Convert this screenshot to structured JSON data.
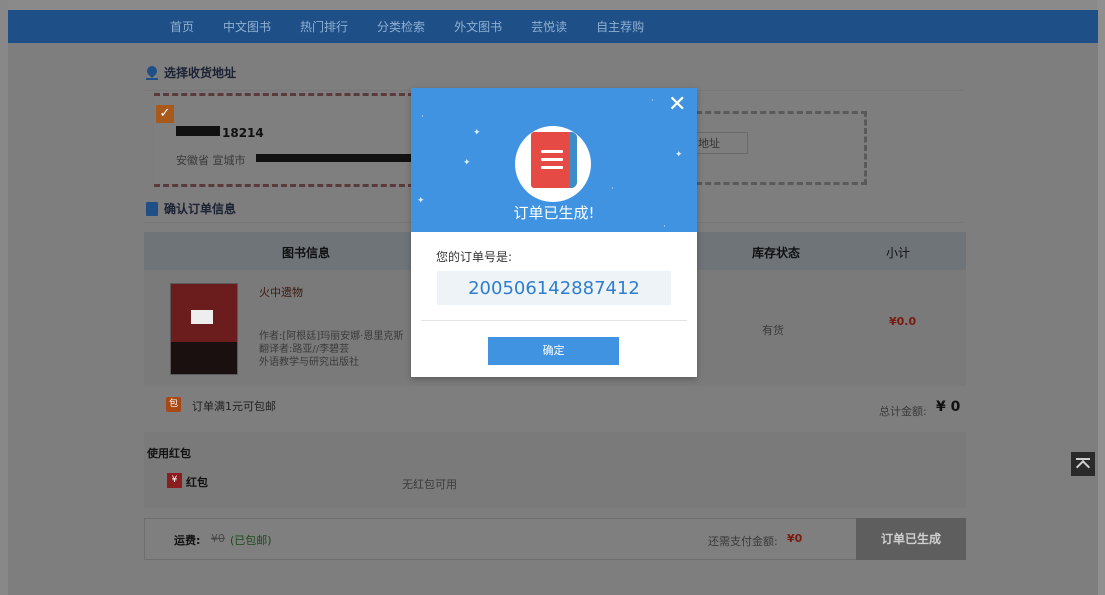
{
  "nav": {
    "items": [
      "首页",
      "中文图书",
      "热门排行",
      "分类检索",
      "外文图书",
      "芸悦读",
      "自主荐购"
    ]
  },
  "address_section": {
    "title": "选择收货地址",
    "selected_card": {
      "check": "✓",
      "phone": "18214",
      "region": "安徽省 宣城市"
    },
    "new_address_button": "地址"
  },
  "order_section": {
    "title": "确认订单信息",
    "headers": {
      "book_info": "图书信息",
      "stock": "库存状态",
      "subtotal": "小计"
    },
    "book": {
      "title": "火中遗物",
      "author": "作者:[阿根廷]玛丽安娜·恩里克斯",
      "translator": "翻译者:路亚//李碧芸",
      "publisher": "外语教学与研究出版社",
      "stock": "有货",
      "price": "¥0.0"
    },
    "shipping_note": "订单满1元可包邮",
    "total_label": "总计金额:",
    "total_value": "¥ 0"
  },
  "redpack": {
    "title": "使用红包",
    "label": "红包",
    "none_text": "无红包可用"
  },
  "footer": {
    "fee_label": "运费:",
    "fee_old": "¥0",
    "fee_note": "(已包邮)",
    "due_label": "还需支付金额:",
    "due_value": "¥0",
    "button": "订单已生成"
  },
  "modal": {
    "title": "订单已生成!",
    "order_label": "您的订单号是:",
    "order_number": "200506142887412",
    "confirm": "确定",
    "close": "✕"
  },
  "colors": {
    "nav_bg": "#1e4f86",
    "modal_header": "#3f93e1",
    "order_number": "#2e7ed0",
    "price_red": "#7a1a0e"
  },
  "icons": [
    "location-icon",
    "document-icon",
    "book-icon",
    "close-icon",
    "back-to-top-icon",
    "redpack-icon",
    "shipping-icon"
  ]
}
